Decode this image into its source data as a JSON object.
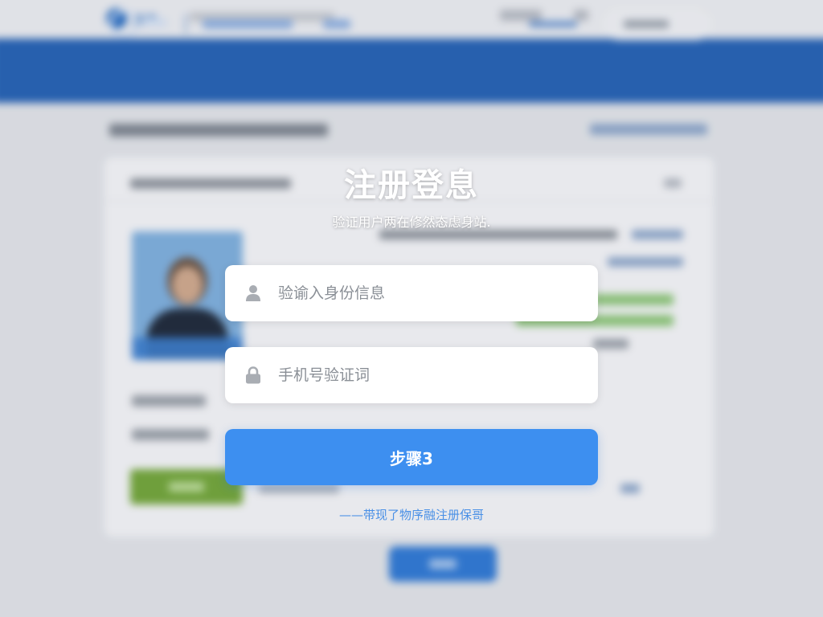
{
  "background_page": {
    "logo_text": "开发"
  },
  "modal": {
    "title": "注册登息",
    "subtitle": "验证用户两在修然态虑身站.",
    "identity_field": {
      "placeholder": "验谕入身份信息",
      "icon": "user-icon"
    },
    "phone_code_field": {
      "placeholder": "手机号验证词",
      "icon": "lock-icon"
    },
    "step_button_label": "步骤3",
    "register_link": "——带现了物序融注册保哥"
  },
  "colors": {
    "accent": "#3d8ff0",
    "link": "#4a90e6",
    "nav_blue": "#2563b6",
    "field_bg": "#ffffff"
  }
}
